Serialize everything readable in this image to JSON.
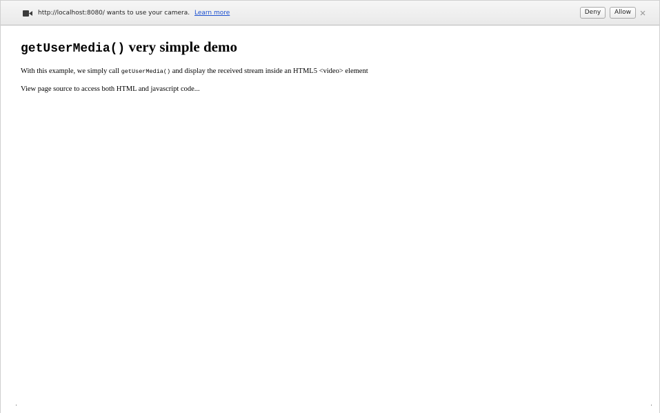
{
  "infobar": {
    "icon": "video-camera-icon",
    "message": "http://localhost:8080/ wants to use your camera.",
    "learn_more": "Learn more",
    "deny_label": "Deny",
    "allow_label": "Allow",
    "close_label": "×"
  },
  "page": {
    "title_code": "getUserMedia()",
    "title_text": " very simple demo",
    "p1_before": "With this example, we simply call ",
    "p1_code": "getUserMedia()",
    "p1_after": " and display the received stream inside an HTML5 <video> element",
    "p2": "View page source to access both HTML and javascript code..."
  }
}
